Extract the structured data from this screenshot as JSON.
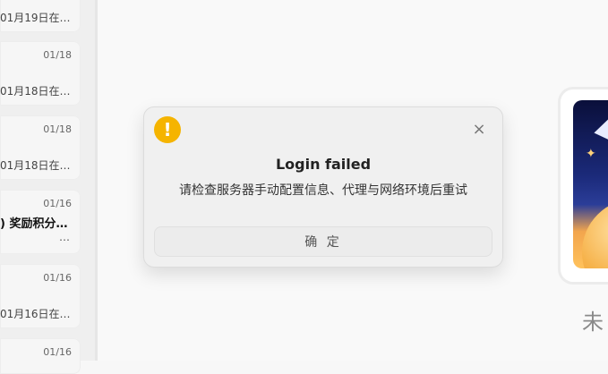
{
  "conversations": [
    {
      "date": "",
      "title": "",
      "preview": "01月19日在…"
    },
    {
      "date": "01/18",
      "title": "",
      "preview": "01月18日在…"
    },
    {
      "date": "01/18",
      "title": "",
      "preview": "01月18日在…"
    },
    {
      "date": "01/16",
      "title": ") 奖励积分…",
      "preview": "…"
    },
    {
      "date": "01/16",
      "title": "",
      "preview": "01月16日在…"
    },
    {
      "date": "01/16",
      "title": "",
      "preview": ""
    }
  ],
  "main": {
    "unread_label": "未"
  },
  "dialog": {
    "title": "Login failed",
    "message": "请检查服务器手动配置信息、代理与网络环境后重试",
    "confirm_label": "确 定",
    "warning_icon": "!",
    "close_icon": "×"
  },
  "colors": {
    "warning": "#f5b400"
  }
}
